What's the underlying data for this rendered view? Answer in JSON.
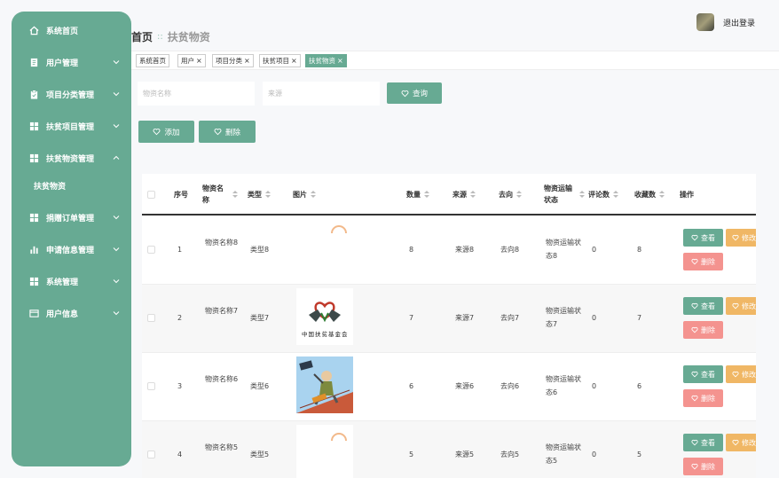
{
  "sidebar": {
    "items": [
      {
        "label": "系统首页",
        "icon": "home-icon"
      },
      {
        "label": "用户管理",
        "icon": "document-icon"
      },
      {
        "label": "项目分类管理",
        "icon": "clipboard-icon"
      },
      {
        "label": "扶贫项目管理",
        "icon": "grid-icon"
      },
      {
        "label": "扶贫物资管理",
        "icon": "grid-icon"
      },
      {
        "label": "捐赠订单管理",
        "icon": "grid-icon"
      },
      {
        "label": "申请信息管理",
        "icon": "bar-chart-icon"
      },
      {
        "label": "系统管理",
        "icon": "grid-icon"
      },
      {
        "label": "用户信息",
        "icon": "card-icon"
      }
    ],
    "submenu": {
      "label": "扶贫物资"
    }
  },
  "breadcrumb": {
    "home": "首页",
    "separator": "::",
    "current": "扶贫物资"
  },
  "header": {
    "logout": "退出登录"
  },
  "tabs": [
    {
      "label": "系统首页",
      "closable": false
    },
    {
      "label": "用户",
      "closable": true
    },
    {
      "label": "项目分类",
      "closable": true
    },
    {
      "label": "扶贫项目",
      "closable": true
    },
    {
      "label": "扶贫物资",
      "closable": true
    }
  ],
  "search": {
    "name_placeholder": "物资名称",
    "source_placeholder": "来源",
    "query_label": "查询"
  },
  "actions": {
    "add_label": "添加",
    "delete_label": "删除"
  },
  "table": {
    "columns": {
      "index": "序号",
      "name": "物资名称",
      "type": "类型",
      "image": "图片",
      "quantity": "数量",
      "source": "来源",
      "destination": "去向",
      "status": "物资运输状态",
      "comments": "评论数",
      "favorites": "收藏数",
      "operation": "操作"
    },
    "row_actions": {
      "view": "查看",
      "edit": "修改",
      "delete": "删除"
    },
    "rows": [
      {
        "index": "1",
        "name": "物资名称8",
        "type": "类型8",
        "quantity": "8",
        "source": "来源8",
        "destination": "去向8",
        "status": "物资运输状态8",
        "comments": "0",
        "favorites": "8",
        "image": "partial-orange"
      },
      {
        "index": "2",
        "name": "物资名称7",
        "type": "类型7",
        "quantity": "7",
        "source": "来源7",
        "destination": "去向7",
        "status": "物资运输状态7",
        "comments": "0",
        "favorites": "7",
        "image": "foundation-logo",
        "image_text": "中国扶贫基金会"
      },
      {
        "index": "3",
        "name": "物资名称6",
        "type": "类型6",
        "quantity": "6",
        "source": "来源6",
        "destination": "去向6",
        "status": "物资运输状态6",
        "comments": "0",
        "favorites": "6",
        "image": "cartoon-illustration"
      },
      {
        "index": "4",
        "name": "物资名称5",
        "type": "类型5",
        "quantity": "5",
        "source": "来源5",
        "destination": "去向5",
        "status": "物资运输状态5",
        "comments": "0",
        "favorites": "5",
        "image": "partial-orange"
      }
    ]
  },
  "colors": {
    "accent": "#67aa93",
    "edit": "#f0b765",
    "delete": "#f4938f"
  }
}
